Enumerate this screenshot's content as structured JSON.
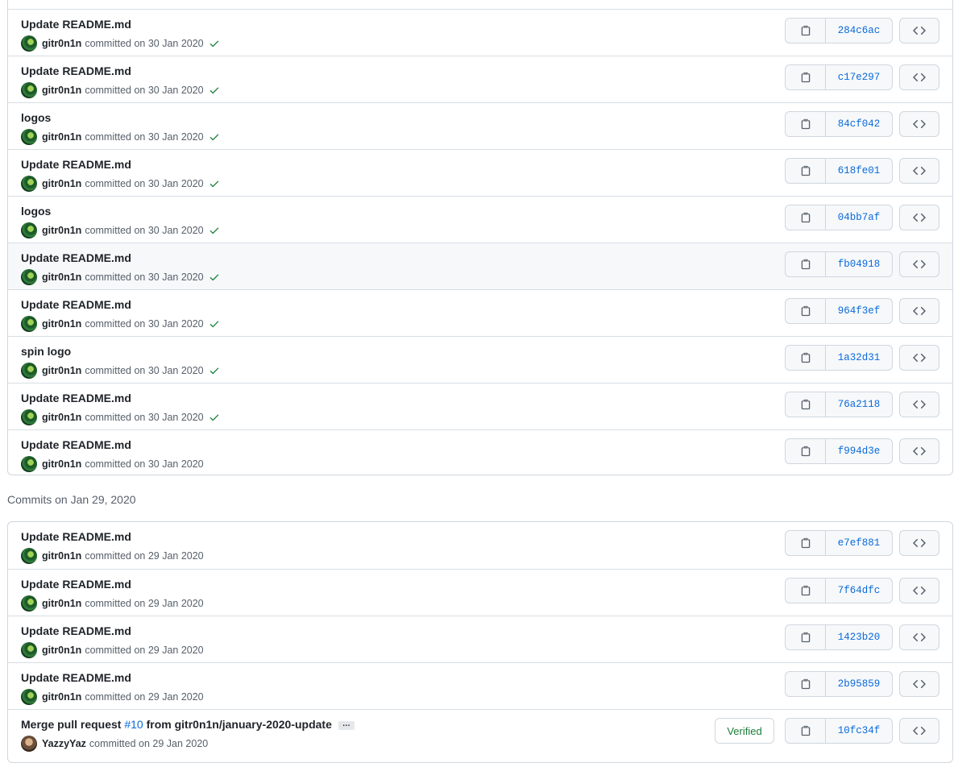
{
  "groups": [
    {
      "heading": "",
      "commits": [
        {
          "title": "Update README.md",
          "author": "gitr0n1n",
          "date": "committed on 30 Jan 2020",
          "sha": "284c6ac",
          "check": true
        },
        {
          "title": "Update README.md",
          "author": "gitr0n1n",
          "date": "committed on 30 Jan 2020",
          "sha": "c17e297",
          "check": true
        },
        {
          "title": "logos",
          "author": "gitr0n1n",
          "date": "committed on 30 Jan 2020",
          "sha": "84cf042",
          "check": true
        },
        {
          "title": "Update README.md",
          "author": "gitr0n1n",
          "date": "committed on 30 Jan 2020",
          "sha": "618fe01",
          "check": true
        },
        {
          "title": "logos",
          "author": "gitr0n1n",
          "date": "committed on 30 Jan 2020",
          "sha": "04bb7af",
          "check": true
        },
        {
          "title": "Update README.md",
          "author": "gitr0n1n",
          "date": "committed on 30 Jan 2020",
          "sha": "fb04918",
          "check": true
        },
        {
          "title": "Update README.md",
          "author": "gitr0n1n",
          "date": "committed on 30 Jan 2020",
          "sha": "964f3ef",
          "check": true
        },
        {
          "title": "spin logo",
          "author": "gitr0n1n",
          "date": "committed on 30 Jan 2020",
          "sha": "1a32d31",
          "check": true
        },
        {
          "title": "Update README.md",
          "author": "gitr0n1n",
          "date": "committed on 30 Jan 2020",
          "sha": "76a2118",
          "check": true
        },
        {
          "title": "Update README.md",
          "author": "gitr0n1n",
          "date": "committed on 30 Jan 2020",
          "sha": "f994d3e",
          "check": false
        }
      ]
    },
    {
      "heading": "Commits on Jan 29, 2020",
      "commits": [
        {
          "title": "Update README.md",
          "author": "gitr0n1n",
          "date": "committed on 29 Jan 2020",
          "sha": "e7ef881",
          "check": false
        },
        {
          "title": "Update README.md",
          "author": "gitr0n1n",
          "date": "committed on 29 Jan 2020",
          "sha": "7f64dfc",
          "check": false
        },
        {
          "title": "Update README.md",
          "author": "gitr0n1n",
          "date": "committed on 29 Jan 2020",
          "sha": "1423b20",
          "check": false
        },
        {
          "title": "Update README.md",
          "author": "gitr0n1n",
          "date": "committed on 29 Jan 2020",
          "sha": "2b95859",
          "check": false
        },
        {
          "title_prefix": "Merge pull request ",
          "pr_link": "#10",
          "title_suffix": " from gitr0n1n/january-2020-update",
          "ellipsis": "…",
          "author": "YazzyYaz",
          "date": "committed on 29 Jan 2020",
          "sha": "10fc34f",
          "verified": "Verified",
          "check": false
        }
      ]
    }
  ],
  "icons": {
    "copy": "clipboard-icon",
    "browse": "code-icon",
    "check": "check-icon"
  },
  "colors": {
    "link": "#0969da",
    "success": "#1a7f37",
    "border": "#d0d7de",
    "highlight_row": "#f6f8fa"
  }
}
